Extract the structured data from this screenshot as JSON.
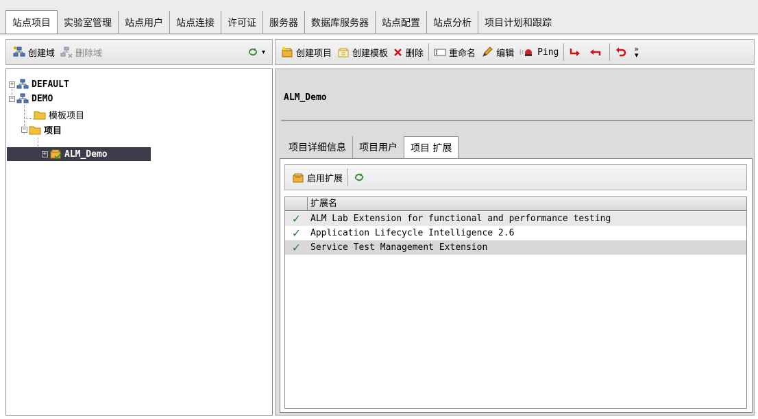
{
  "top_tabs": [
    {
      "label": "站点项目"
    },
    {
      "label": "实验室管理"
    },
    {
      "label": "站点用户"
    },
    {
      "label": "站点连接"
    },
    {
      "label": "许可证"
    },
    {
      "label": "服务器"
    },
    {
      "label": "数据库服务器"
    },
    {
      "label": "站点配置"
    },
    {
      "label": "站点分析"
    },
    {
      "label": "项目计划和跟踪"
    }
  ],
  "left_toolbar": {
    "create_domain": "创建域",
    "delete_domain": "删除域"
  },
  "tree": {
    "nodes": [
      {
        "label": "DEFAULT"
      },
      {
        "label": "DEMO"
      },
      {
        "label": "模板项目"
      },
      {
        "label": "项目"
      },
      {
        "label": "ALM_Demo"
      }
    ]
  },
  "right_toolbar": {
    "create_project": "创建项目",
    "create_template": "创建模板",
    "delete": "删除",
    "rename": "重命名",
    "edit": "编辑",
    "ping": "Ping"
  },
  "project": {
    "title": "ALM_Demo"
  },
  "sub_tabs": [
    {
      "label": "项目详细信息"
    },
    {
      "label": "项目用户"
    },
    {
      "label": "项目 扩展"
    }
  ],
  "extensions": {
    "enable_label": "启用扩展",
    "column_header": "扩展名",
    "rows": [
      {
        "name": "ALM Lab Extension for functional and performance testing",
        "enabled": "✓"
      },
      {
        "name": "Application Lifecycle Intelligence 2.6",
        "enabled": "✓"
      },
      {
        "name": "Service Test Management Extension",
        "enabled": "✓"
      }
    ]
  },
  "colors": {
    "accent_green": "#2e7d2e",
    "selection_bg": "#3b3b4a"
  }
}
